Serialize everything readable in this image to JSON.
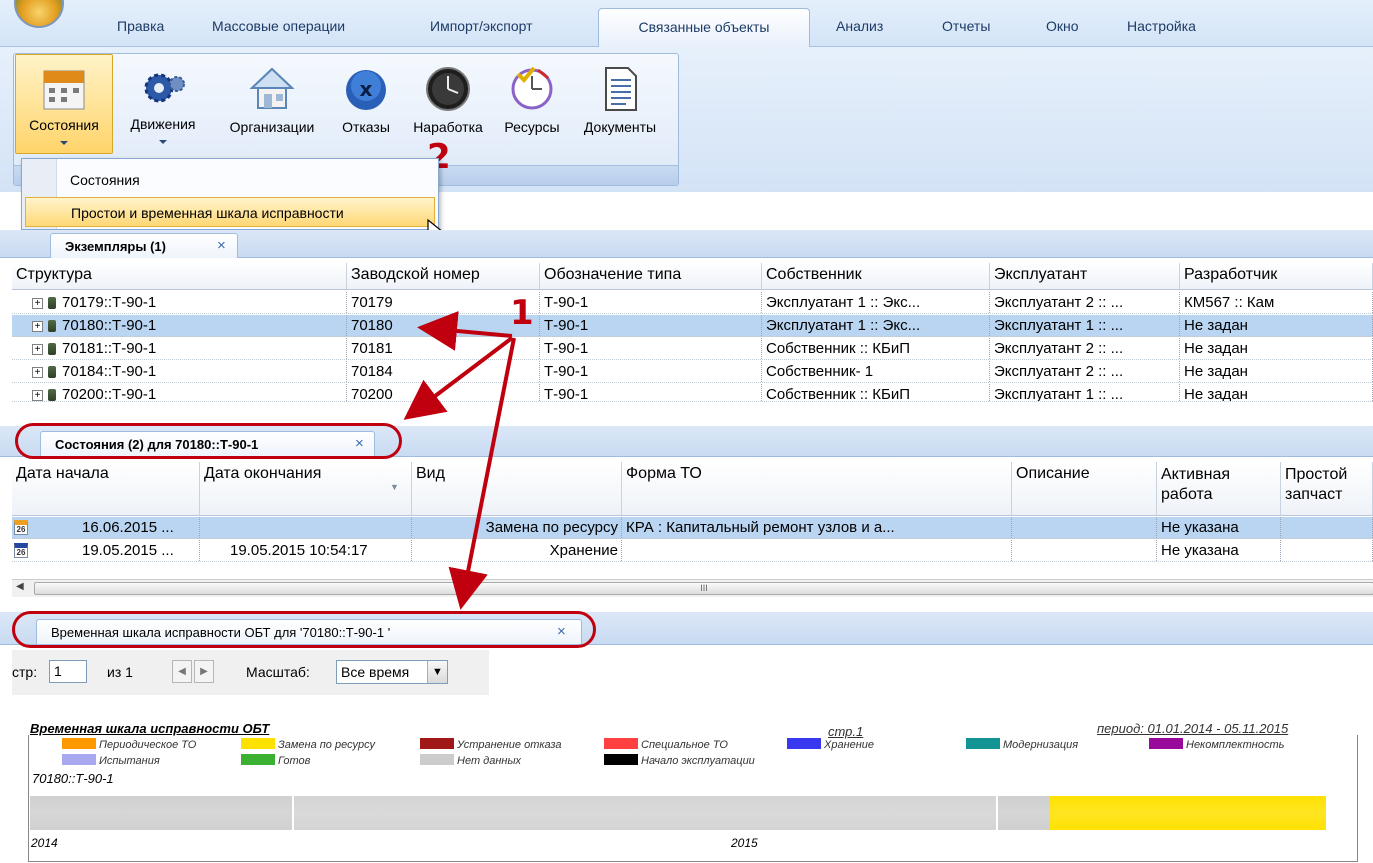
{
  "menu": {
    "tabs": [
      "Правка",
      "Массовые операции",
      "Импорт/экспорт",
      "Связанные объекты",
      "Анализ",
      "Отчеты",
      "Окно",
      "Настройка"
    ]
  },
  "ribbon": {
    "buttons": [
      "Состояния",
      "Движения",
      "Организации",
      "Отказы",
      "Наработка",
      "Ресурсы",
      "Документы"
    ]
  },
  "dropdown": {
    "items": [
      "Состояния",
      "Простои и временная шкала исправности"
    ]
  },
  "annotations": {
    "n1": "1",
    "n2": "2"
  },
  "instances": {
    "tab_label": "Экземпляры (1)",
    "columns": [
      "Структура",
      "Заводской номер",
      "Обозначение типа",
      "Собственник",
      "Эксплуатант",
      "Разработчик"
    ],
    "rows": [
      [
        "70179::Т-90-1",
        "70179",
        "Т-90-1",
        "Эксплуатант 1 :: Экс...",
        "Эксплуатант 2 :: ...",
        "КМ567 :: Кам"
      ],
      [
        "70180::Т-90-1",
        "70180",
        "Т-90-1",
        "Эксплуатант 1 :: Экс...",
        "Эксплуатант 1 :: ...",
        "Не задан"
      ],
      [
        "70181::Т-90-1",
        "70181",
        "Т-90-1",
        "Собственник :: КБиП",
        "Эксплуатант 2 :: ...",
        "Не задан"
      ],
      [
        "70184::Т-90-1",
        "70184",
        "Т-90-1",
        "Собственник- 1",
        "Эксплуатант 2 :: ...",
        "Не задан"
      ],
      [
        "70200::Т-90-1",
        "70200",
        "Т-90-1",
        "Собственник :: КБиП",
        "Эксплуатант 1 :: ...",
        "Не задан"
      ]
    ]
  },
  "states": {
    "tab_label": "Состояния (2) для 70180::Т-90-1",
    "columns": [
      "Дата начала",
      "Дата окончания",
      "Вид",
      "Форма ТО",
      "Описание",
      "Активная работа",
      "Простой запчаст"
    ],
    "rows": [
      [
        "16.06.2015 ...",
        "",
        "Замена по ресурсу",
        "КРА : Капитальный ремонт узлов и а...",
        "",
        "Не указана",
        ""
      ],
      [
        "19.05.2015 ...",
        "19.05.2015 10:54:17",
        "Хранение",
        "",
        "",
        "Не указана",
        ""
      ]
    ],
    "scroll_grip": "III"
  },
  "timeline": {
    "tab_label": "Временная шкала исправности ОБТ для  '70180::Т-90-1  '",
    "toolbar": {
      "page_label": "стр:",
      "page_value": "1",
      "of_label": "из 1",
      "scale_label": "Масштаб:",
      "scale_value": "Все время"
    },
    "report": {
      "title": "Временная шкала исправности ОБТ",
      "page": "стр.1",
      "period": "период: 01.01.2014 - 05.11.2015",
      "object": "70180::Т-90-1",
      "year_start": "2014",
      "year_mid": "2015",
      "legend": [
        {
          "label": "Периодическое ТО",
          "color": "#ff9900"
        },
        {
          "label": "Замена по ресурсу",
          "color": "#ffe100"
        },
        {
          "label": "Устранение отказа",
          "color": "#a01818"
        },
        {
          "label": "Специальное ТО",
          "color": "#ff4040"
        },
        {
          "label": "Хранение",
          "color": "#3838f0"
        },
        {
          "label": "Модернизация",
          "color": "#129494"
        },
        {
          "label": "Некомплектность",
          "color": "#9a0a9a"
        },
        {
          "label": "Испытания",
          "color": "#a8a8f0"
        },
        {
          "label": "Готов",
          "color": "#3cb030"
        },
        {
          "label": "Нет данных",
          "color": "#cccccc"
        },
        {
          "label": "Начало эксплуатации",
          "color": "#000000"
        }
      ],
      "bars": [
        {
          "state": "Нет данных",
          "color": "#d0d0d0"
        },
        {
          "state": "Нет данных",
          "color": "#d4d4d4"
        },
        {
          "state": "Нет данных",
          "color": "#cfcfcf"
        },
        {
          "state": "Замена по ресурсу",
          "color": "#ffe100"
        }
      ]
    }
  }
}
